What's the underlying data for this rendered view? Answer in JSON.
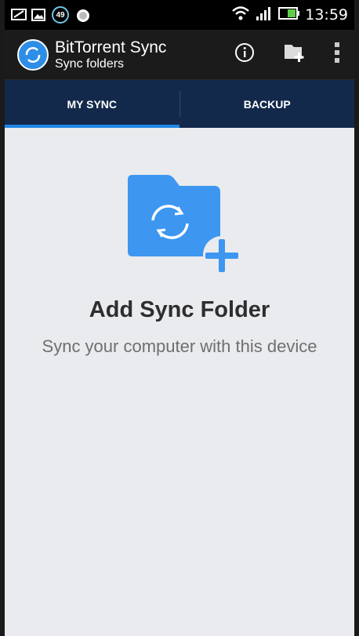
{
  "status_bar": {
    "notification_count": "49",
    "time": "13:59"
  },
  "app_bar": {
    "title": "BitTorrent Sync",
    "subtitle": "Sync folders",
    "icons": [
      "info-icon",
      "add-folder-icon",
      "overflow-menu-icon"
    ]
  },
  "tabs": [
    {
      "label": "MY SYNC",
      "active": true
    },
    {
      "label": "BACKUP",
      "active": false
    }
  ],
  "empty_state": {
    "title": "Add Sync Folder",
    "subtitle": "Sync your computer with this device"
  },
  "colors": {
    "accent": "#2d8ee6",
    "tab_bar": "#13294b",
    "app_bar": "#1b1b1b",
    "background": "#e9ebee"
  }
}
